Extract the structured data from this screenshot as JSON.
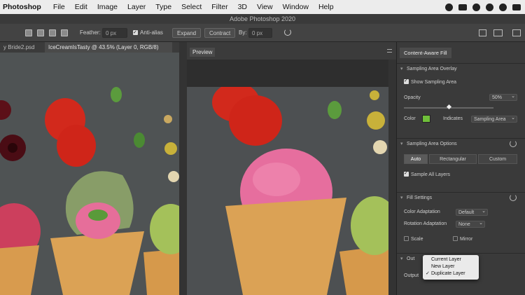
{
  "menubar": {
    "app": "Photoshop",
    "items": [
      "File",
      "Edit",
      "Image",
      "Layer",
      "Type",
      "Select",
      "Filter",
      "3D",
      "View",
      "Window",
      "Help"
    ]
  },
  "titlebar": {
    "title": "Adobe Photoshop 2020"
  },
  "options": {
    "feather_label": "Feather:",
    "feather_value": "0 px",
    "antialias_label": "Anti-alias",
    "expand_label": "Expand",
    "contract_label": "Contract",
    "by_label": "By:",
    "by_value": "0 px"
  },
  "doc_tabs": [
    {
      "label": "y Bride2.psd"
    },
    {
      "label": "IceCreamIsTasty @ 43.5% (Layer 0, RGB/8)"
    }
  ],
  "preview": {
    "label": "Preview"
  },
  "panel": {
    "title": "Content-Aware Fill",
    "sampling_overlay": {
      "header": "Sampling Area Overlay",
      "show_label": "Show Sampling Area",
      "opacity_label": "Opacity",
      "opacity_value": "50%",
      "color_label": "Color",
      "indicates_label": "Indicates",
      "indicates_value": "Sampling Area",
      "opacity_level": 0.5
    },
    "sampling_options": {
      "header": "Sampling Area Options",
      "modes": [
        "Auto",
        "Rectangular",
        "Custom"
      ],
      "sample_all_label": "Sample All Layers"
    },
    "fill_settings": {
      "header": "Fill Settings",
      "color_adaptation_label": "Color Adaptation",
      "color_adaptation_value": "Default",
      "rotation_adaptation_label": "Rotation Adaptation",
      "rotation_adaptation_value": "None",
      "scale_label": "Scale",
      "mirror_label": "Mirror"
    },
    "output": {
      "header": "Out",
      "output_label": "Output"
    }
  },
  "output_menu": {
    "options": [
      "Current Layer",
      "New Layer",
      "Duplicate Layer"
    ],
    "selected": "Duplicate Layer"
  },
  "colors": {
    "overlay_green": "#6fbf3a",
    "panel_bg": "#3a3a3a",
    "app_bg": "#2b2b2b"
  }
}
